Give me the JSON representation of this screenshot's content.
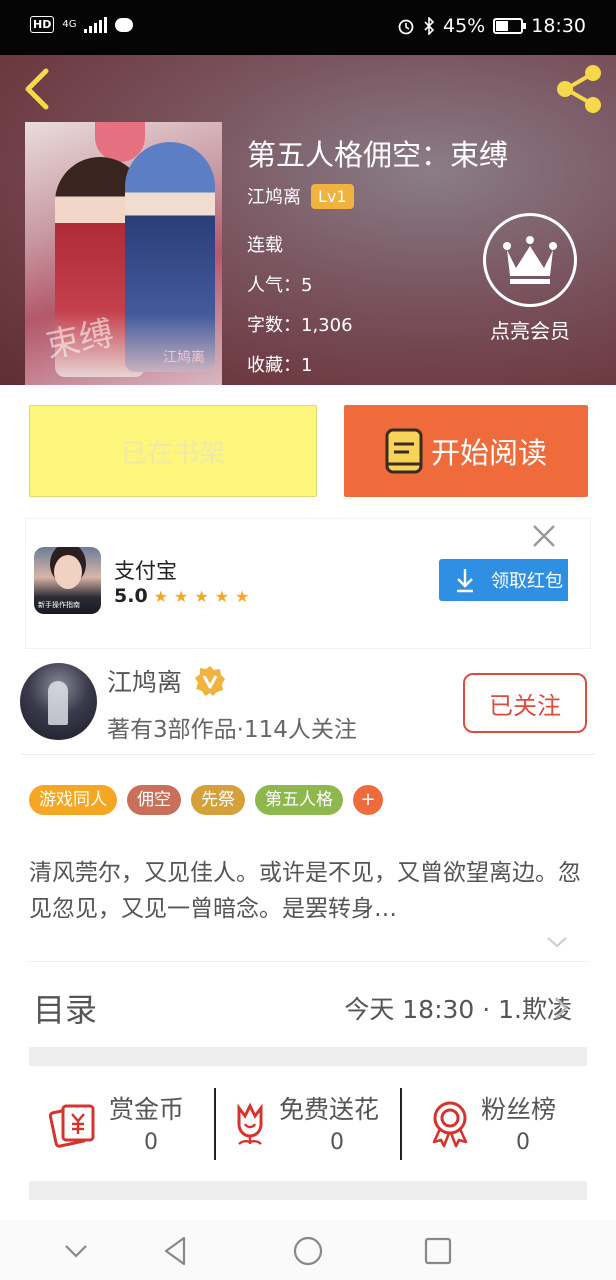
{
  "status_bar": {
    "hd": "HD",
    "network": "4G",
    "battery_percent": "45%",
    "battery_level": 0.45,
    "time": "18:30"
  },
  "book": {
    "title": "第五人格佣空：束缚",
    "author": "江鸠离",
    "level": "Lv1",
    "status": "连载",
    "popularity": "人气：5",
    "word_count": "字数：1,306",
    "favorites": "收藏：1",
    "cover_text": "束缚",
    "cover_signature": "江鸠离"
  },
  "vip": {
    "label": "点亮会员"
  },
  "actions": {
    "shelf_label": "已在书架",
    "read_label": "开始阅读"
  },
  "ad": {
    "app_name": "支付宝",
    "rating": "5.0",
    "stars": "★★★★★",
    "download_label": "领取红包",
    "thumb_caption": "新手操作指南"
  },
  "author_info": {
    "name": "江鸠离",
    "description": "著有3部作品·114人关注",
    "follow_label": "已关注"
  },
  "tags": [
    {
      "label": "游戏同人",
      "color": "#f5a623"
    },
    {
      "label": "佣空",
      "color": "#c8705a"
    },
    {
      "label": "先祭",
      "color": "#d6a03c"
    },
    {
      "label": "第五人格",
      "color": "#8eb84e"
    }
  ],
  "tag_plus": "+",
  "synopsis": "清风莞尔，又见佳人。或许是不见，又曾欲望离边。忽见忽见，又见一曾暗念。是罢转身…",
  "toc": {
    "title": "目录",
    "latest": "今天 18:30 · 1.欺凌"
  },
  "stats": [
    {
      "label": "赏金币",
      "value": "0",
      "icon": "reward-coin-icon"
    },
    {
      "label": "免费送花",
      "value": "0",
      "icon": "flower-icon"
    },
    {
      "label": "粉丝榜",
      "value": "0",
      "icon": "medal-icon"
    }
  ],
  "colors": {
    "accent": "#ef6b3b",
    "shelf_button": "#fef67c",
    "follow": "#e24a3c",
    "level_badge": "#f2b23f",
    "download": "#2f8fe3"
  }
}
